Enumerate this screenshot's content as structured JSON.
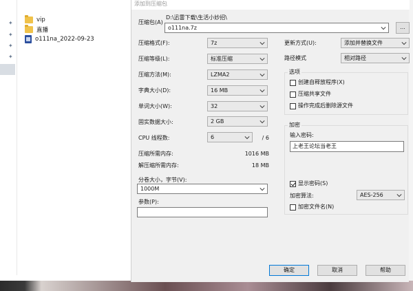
{
  "explorer": {
    "items": [
      {
        "label": "vip",
        "icon": "folder-icon"
      },
      {
        "label": "直播",
        "icon": "folder-icon"
      },
      {
        "label": "o111na_2022-09-23",
        "icon": "archive-file-icon"
      }
    ]
  },
  "dialog": {
    "title": "添加到压缩包",
    "archive": {
      "label": "压缩包(A)",
      "path": "D:\\迅雷下载\\生活小妙招\\",
      "filename": "o111na.7z",
      "browse_label": "..."
    },
    "left": {
      "format": {
        "label": "压缩格式(F):",
        "value": "7z"
      },
      "level": {
        "label": "压缩等级(L):",
        "value": "标准压缩"
      },
      "method": {
        "label": "压缩方法(M):",
        "value": "LZMA2"
      },
      "dict": {
        "label": "字典大小(D):",
        "value": "16 MB"
      },
      "word": {
        "label": "单词大小(W):",
        "value": "32"
      },
      "solid": {
        "label": "固实数据大小:",
        "value": "2 GB"
      },
      "threads": {
        "label": "CPU 线程数:",
        "value": "6",
        "max": "/ 6"
      },
      "mem_compress": {
        "label": "压缩所需内存:",
        "value": "1016 MB"
      },
      "mem_decompress": {
        "label": "解压缩所需内存:",
        "value": "18 MB"
      },
      "volume": {
        "label": "分卷大小，字节(V):",
        "value": "1000M"
      },
      "params": {
        "label": "参数(P):",
        "value": ""
      }
    },
    "right": {
      "update": {
        "label": "更新方式(U):",
        "value": "添加并替换文件"
      },
      "pathmode": {
        "label": "路径模式",
        "value": "相对路径"
      },
      "options": {
        "title": "选项",
        "sfx": "创建自释放程序(X)",
        "shared": "压缩共享文件",
        "delete": "操作完成后删除源文件"
      },
      "encryption": {
        "title": "加密",
        "password_label": "输入密码:",
        "password_value": "上老王论坛当老王",
        "show_password": "显示密码(S)",
        "method_label": "加密算法:",
        "method_value": "AES-256",
        "encrypt_names": "加密文件名(N)"
      }
    },
    "buttons": {
      "ok": "确定",
      "cancel": "取消",
      "help": "帮助"
    }
  }
}
